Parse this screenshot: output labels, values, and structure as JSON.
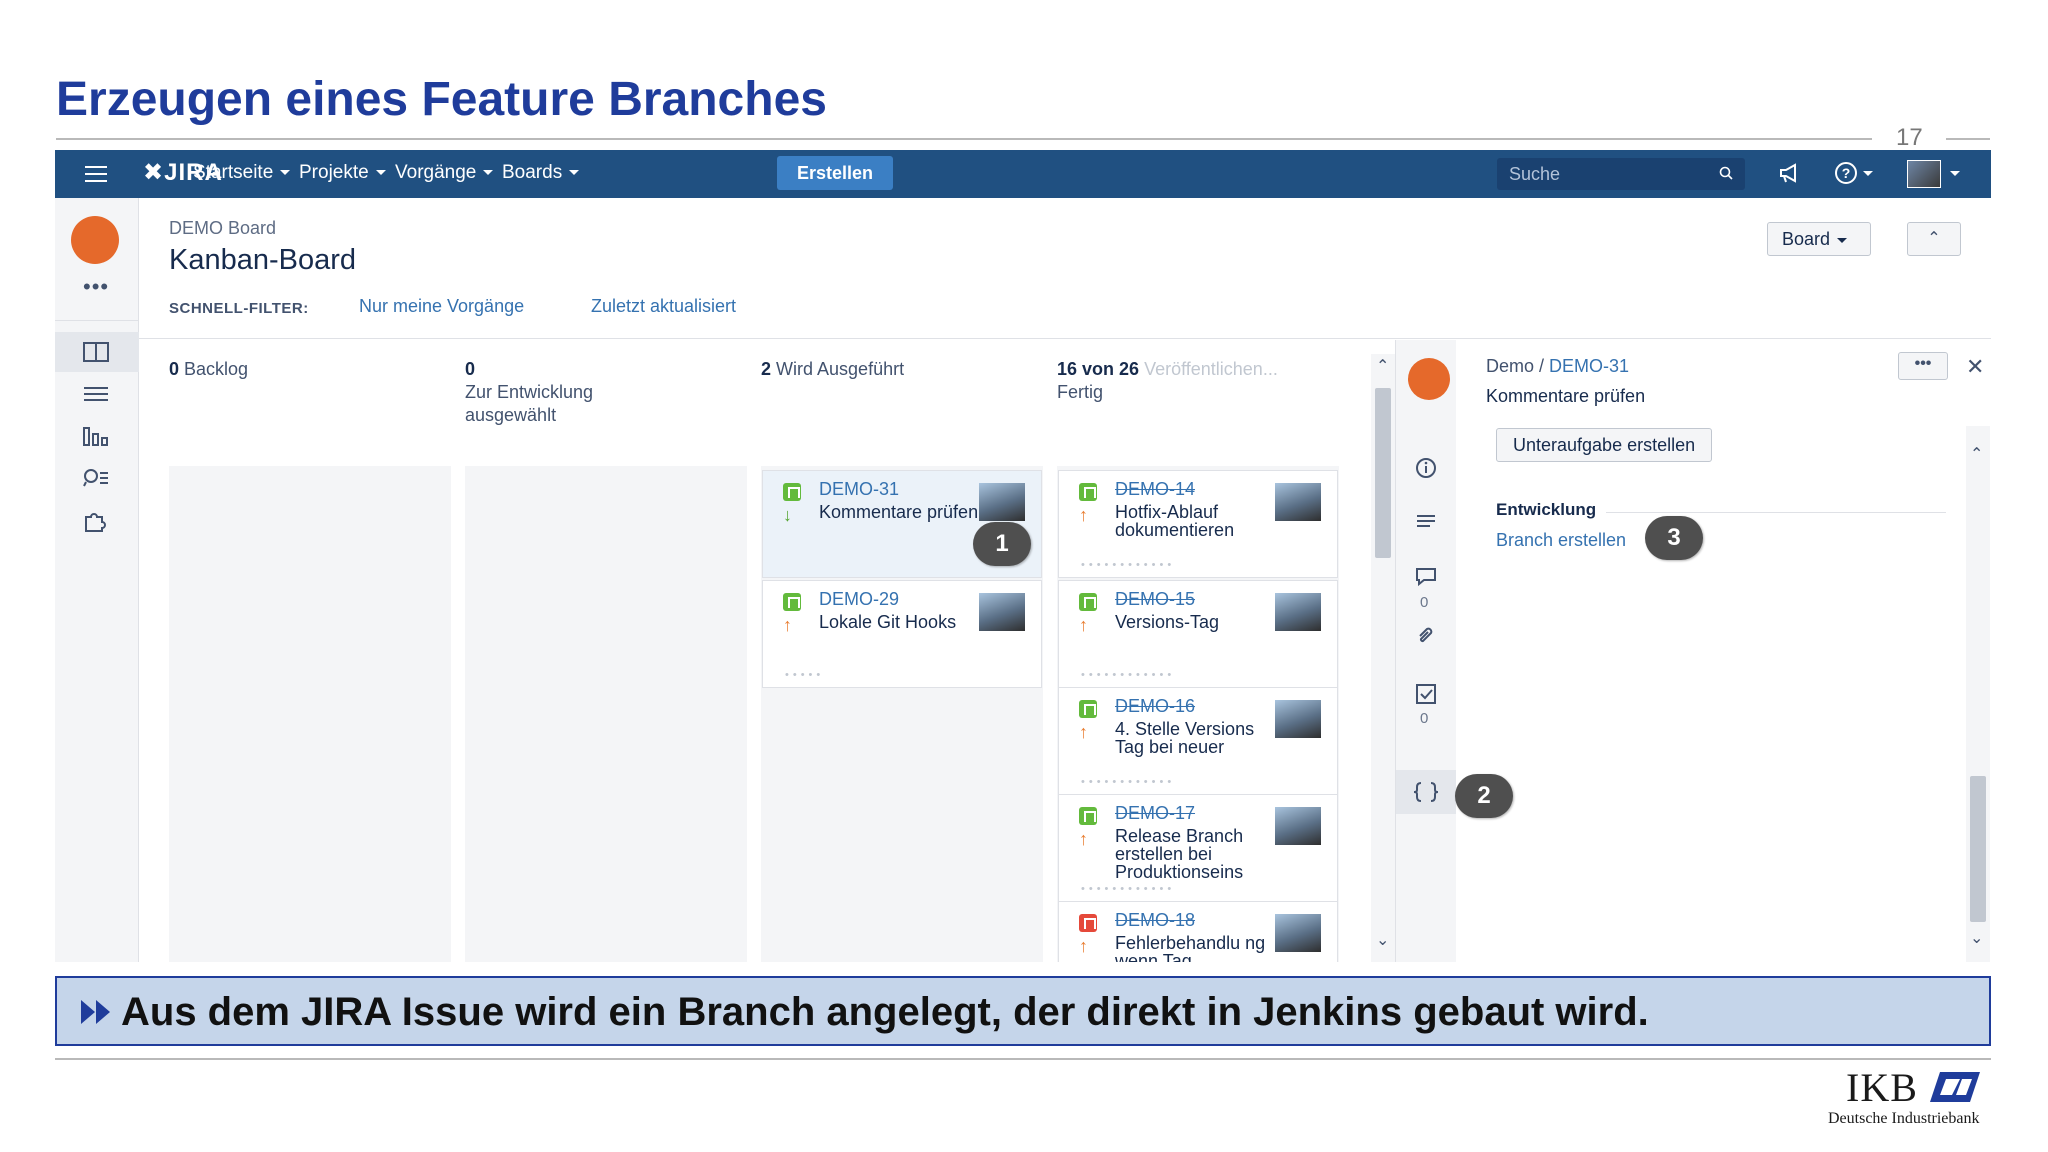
{
  "slide": {
    "title": "Erzeugen eines Feature Branches",
    "page_number": "17",
    "callout": "Aus dem JIRA Issue wird ein Branch angelegt, der direkt in Jenkins gebaut wird.",
    "logo_name": "IKB",
    "logo_subtitle": "Deutsche Industriebank",
    "title_color": "#1f3c9b",
    "callout_bg": "#c5d5ea"
  },
  "jira": {
    "logo": "JIRA",
    "nav": [
      "Startseite",
      "Projekte",
      "Vorgänge",
      "Boards"
    ],
    "create_label": "Erstellen",
    "search_placeholder": "Suche",
    "topbar_color": "#205081"
  },
  "sidebar": {
    "items": [
      "board-icon",
      "backlog-icon",
      "reports-icon",
      "issues-icon",
      "addons-icon"
    ]
  },
  "board": {
    "breadcrumb": "DEMO Board",
    "title": "Kanban-Board",
    "quick_filter_label": "SCHNELL-FILTER:",
    "quick_filters": [
      "Nur meine Vorgänge",
      "Zuletzt aktualisiert"
    ],
    "board_button": "Board"
  },
  "columns": [
    {
      "count": "0",
      "name": "Backlog"
    },
    {
      "count": "0",
      "name": "Zur Entwicklung ausgewählt"
    },
    {
      "count": "2",
      "name": "Wird Ausgeführt"
    },
    {
      "count": "16 von 26",
      "name": "Fertig",
      "release": "Veröffentlichen..."
    }
  ],
  "cards_in_progress": [
    {
      "key": "DEMO-31",
      "summary": "Kommentare prüfen",
      "type": "story",
      "priority": "down",
      "selected": true
    },
    {
      "key": "DEMO-29",
      "summary": "Lokale Git Hooks",
      "type": "story",
      "priority": "up",
      "selected": false
    }
  ],
  "cards_done": [
    {
      "key": "DEMO-14",
      "summary": "Hotfix-Ablauf dokumentieren",
      "type": "story",
      "priority": "up"
    },
    {
      "key": "DEMO-15",
      "summary": "Versions-Tag",
      "type": "story",
      "priority": "up"
    },
    {
      "key": "DEMO-16",
      "summary": "4. Stelle Versions Tag bei neuer",
      "type": "story",
      "priority": "up"
    },
    {
      "key": "DEMO-17",
      "summary": "Release Branch erstellen bei Produktionseins",
      "type": "story",
      "priority": "up"
    },
    {
      "key": "DEMO-18",
      "summary": "Fehlerbehandlu ng wenn Tag",
      "type": "bug",
      "priority": "up"
    }
  ],
  "detail": {
    "project": "Demo",
    "issue_key": "DEMO-31",
    "summary": "Kommentare prüfen",
    "subtask_button": "Unteraufgabe erstellen",
    "dev_heading": "Entwicklung",
    "branch_link": "Branch erstellen",
    "comment_count": "0",
    "checklist_count": "0"
  },
  "markers": [
    "1",
    "2",
    "3"
  ]
}
